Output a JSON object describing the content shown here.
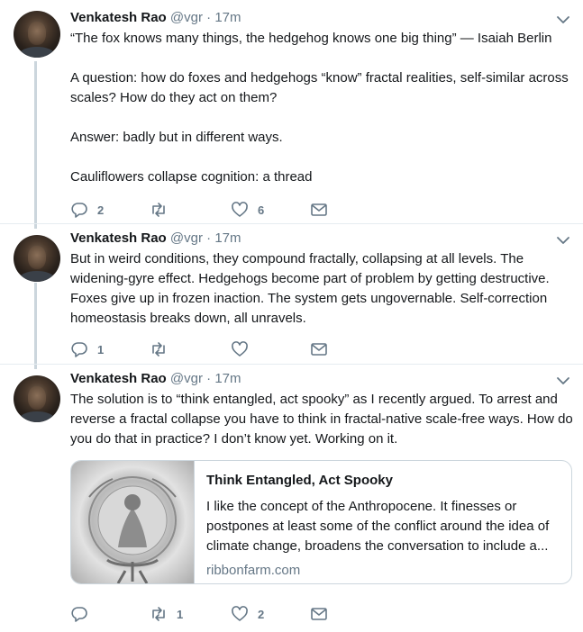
{
  "tweets": [
    {
      "author": {
        "name": "Venkatesh Rao",
        "handle": "@vgr",
        "separator": "·",
        "time": "17m"
      },
      "paragraphs": [
        "“The fox knows many things, the hedgehog knows one big thing” — Isaiah Berlin",
        "A question: how do foxes and hedgehogs “know” fractal realities, self-similar across scales? How do they act on them?",
        "Answer: badly but in different ways.",
        "Cauliflowers collapse cognition: a thread"
      ],
      "actions": {
        "reply_count": "2",
        "retweet_count": "",
        "like_count": "6"
      }
    },
    {
      "author": {
        "name": "Venkatesh Rao",
        "handle": "@vgr",
        "separator": "·",
        "time": "17m"
      },
      "paragraphs": [
        "But in weird conditions, they compound fractally, collapsing at all levels. The widening-gyre effect. Hedgehogs become part of problem by getting destructive. Foxes give up in frozen inaction. The system gets ungovernable. Self-correction homeostasis breaks down, all unravels."
      ],
      "actions": {
        "reply_count": "1",
        "retweet_count": "",
        "like_count": ""
      }
    },
    {
      "author": {
        "name": "Venkatesh Rao",
        "handle": "@vgr",
        "separator": "·",
        "time": "17m"
      },
      "paragraphs": [
        "The solution is to “think entangled, act spooky” as I recently argued. To arrest and reverse a fractal collapse you have to think in fractal-native scale-free ways. How do you do that in practice? I don’t know yet. Working on it."
      ],
      "card": {
        "title": "Think Entangled, Act Spooky",
        "description": "I like the concept of the Anthropocene. It finesses or postpones at least some of the conflict around the idea of climate change, broadens the conversation to include a...",
        "domain": "ribbonfarm.com"
      },
      "actions": {
        "reply_count": "",
        "retweet_count": "1",
        "like_count": "2"
      }
    }
  ],
  "colors": {
    "text": "#14171a",
    "muted": "#657786",
    "thread_line": "#ccd6dd",
    "border": "#e6ecf0"
  },
  "icons": [
    "chevron-down-icon",
    "reply-icon",
    "retweet-icon",
    "like-icon",
    "direct-message-icon"
  ]
}
